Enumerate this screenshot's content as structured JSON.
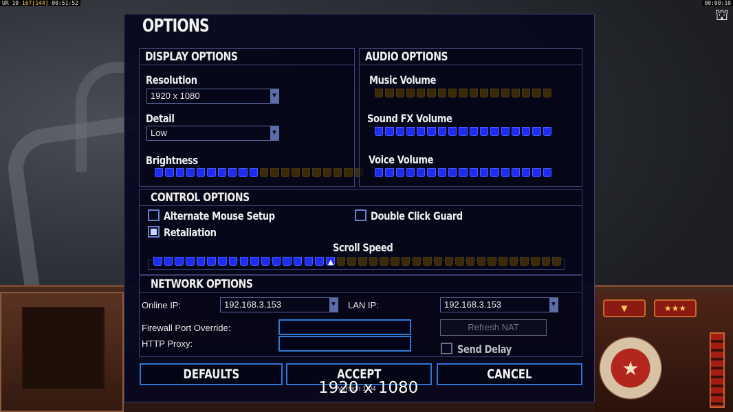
{
  "hud": {
    "top_left_prefix": "UR 10",
    "top_left_fps": "167",
    "top_left_frames": "[144]",
    "top_left_time": "00:51:52",
    "top_right_time": "00:00:10"
  },
  "dialog": {
    "title": "OPTIONS"
  },
  "display": {
    "header": "DISPLAY OPTIONS",
    "resolution_label": "Resolution",
    "resolution_value": "1920 x 1080",
    "detail_label": "Detail",
    "detail_value": "Low",
    "brightness_label": "Brightness",
    "brightness_level": 0.5,
    "brightness_segments": 20
  },
  "audio": {
    "header": "AUDIO OPTIONS",
    "music_label": "Music Volume",
    "music_level": 0,
    "sfx_label": "Sound FX Volume",
    "sfx_level": 1,
    "voice_label": "Voice Volume",
    "voice_level": 1,
    "segments": 17
  },
  "control": {
    "header": "CONTROL OPTIONS",
    "alternate_mouse_label": "Alternate Mouse Setup",
    "alternate_mouse_checked": false,
    "double_click_label": "Double Click Guard",
    "double_click_checked": false,
    "retaliation_label": "Retaliation",
    "retaliation_checked": true,
    "scroll_speed_label": "Scroll Speed",
    "scroll_speed_level": 0.45,
    "scroll_segments": 38
  },
  "network": {
    "header": "NETWORK OPTIONS",
    "online_ip_label": "Online IP:",
    "online_ip_value": "192.168.3.153",
    "lan_ip_label": "LAN IP:",
    "lan_ip_value": "192.168.3.153",
    "firewall_label": "Firewall Port Override:",
    "firewall_value": "",
    "http_proxy_label": "HTTP Proxy:",
    "http_proxy_value": "",
    "refresh_nat_label": "Refresh NAT",
    "send_delay_label": "Send Delay",
    "send_delay_checked": false
  },
  "buttons": {
    "defaults": "DEFAULTS",
    "accept": "ACCEPT",
    "cancel": "CANCEL"
  },
  "version_text": "Version 1.04",
  "resolution_overlay": "1920 x 1080",
  "colors": {
    "dialog_bg": "#06081e",
    "slider_on": "#1d2cf2",
    "slider_off": "#3a2a08",
    "button_border": "#2d74d8"
  }
}
